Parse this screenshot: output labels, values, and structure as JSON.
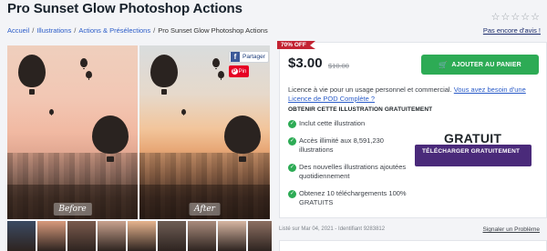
{
  "page": {
    "title": "Pro Sunset Glow Photoshop Actions"
  },
  "rating": {
    "stars": 5,
    "no_review_link": "Pas encore d'avis !"
  },
  "breadcrumb": {
    "items": [
      "Accueil",
      "Illustrations",
      "Actions & Présélections"
    ],
    "current": "Pro Sunset Glow Photoshop Actions"
  },
  "preview": {
    "before_label": "Before",
    "after_label": "After",
    "share": {
      "facebook_label": "Partager",
      "pinterest_label": "Pin"
    },
    "thumbnail_colors": [
      "#3b4a62",
      "#d89a7c",
      "#7a5a4d",
      "#c9a28e",
      "#e7b48e",
      "#6e5d55",
      "#a98b7c",
      "#d7b6a2",
      "#8c6f62"
    ]
  },
  "purchase": {
    "discount_badge": "70% OFF",
    "price": "$3.00",
    "old_price": "$10.00",
    "add_to_cart_label": "AJOUTER AU PANIER",
    "license_text": "Licence à vie pour un usage personnel et commercial.",
    "license_link": "Vous avez besoin d'une Licence de POD Complète ?",
    "free_heading": "OBTENIR CETTE ILLUSTRATION GRATUITEMENT",
    "benefits": [
      "Inclut cette illustration",
      "Accès illimité aux 8,591,230 illustrations",
      "Des nouvelles illustrations ajoutées quotidiennement",
      "Obtenez 10 téléchargements 100% GRATUITS"
    ],
    "free_title": "GRATUIT",
    "free_button_label": "TÉLÉCHARGER GRATUITEMENT"
  },
  "meta": {
    "listed": "Listé sur Mar 04, 2021 - Identifiant 9283812",
    "report_link": "Signaler un Problème"
  },
  "colors": {
    "cart_green": "#2dab55",
    "download_purple": "#4a2a7a",
    "badge_red": "#c32433",
    "link_blue": "#2b5cc8"
  }
}
